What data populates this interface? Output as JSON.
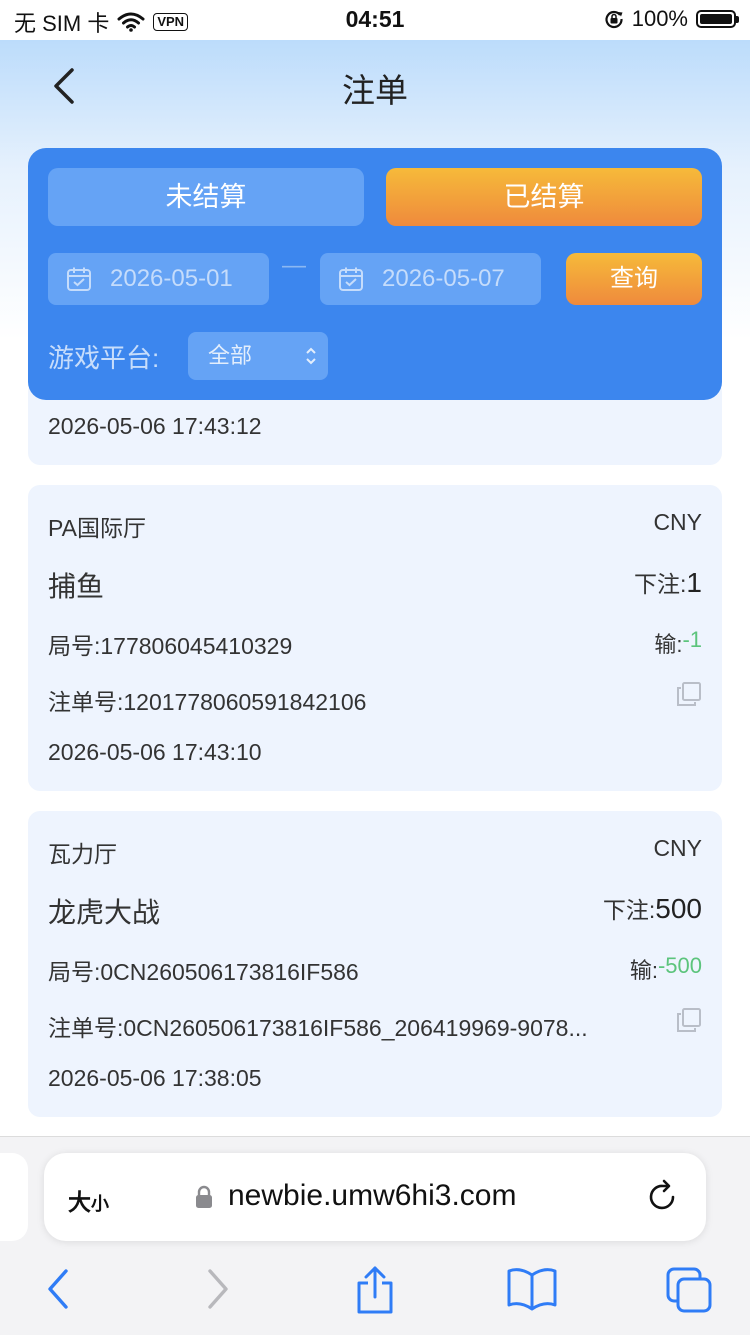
{
  "status_bar": {
    "carrier": "无 SIM 卡",
    "vpn": "VPN",
    "time": "04:51",
    "battery": "100%"
  },
  "header": {
    "title": "注单"
  },
  "filter": {
    "tabs": [
      "未结算",
      "已结算"
    ],
    "active_tab": "已结算",
    "start_date": "2026-05-01",
    "separator": "—",
    "end_date": "2026-05-07",
    "query_label": "查询",
    "platform_label": "游戏平台:",
    "platform_value": "全部"
  },
  "bets": [
    {
      "time": "2026-05-06 17:43:12"
    },
    {
      "hall": "PA国际厅",
      "currency": "CNY",
      "game": "捕鱼",
      "bet_label": "下注:",
      "bet_amount": "1",
      "round_label": "局号:",
      "round_no": "177806045410329",
      "result_label": "输:",
      "result_amount": "-1",
      "order_label": "注单号:",
      "order_no": "1201778060591842106",
      "time": "2026-05-06 17:43:10"
    },
    {
      "hall": "瓦力厅",
      "currency": "CNY",
      "game": "龙虎大战",
      "bet_label": "下注:",
      "bet_amount": "500",
      "round_label": "局号:",
      "round_no": "0CN260506173816IF586",
      "result_label": "输:",
      "result_amount": "-500",
      "order_label": "注单号:",
      "order_no": "0CN260506173816IF586_206419969-9078...",
      "time": "2026-05-06 17:38:05"
    }
  ],
  "browser": {
    "aa_big": "大",
    "aa_small": "小",
    "url": "newbie.umw6hi3.com"
  },
  "colors": {
    "panel_blue": "#3c86ee",
    "orange": "#ef8a3c",
    "loss_green": "#5cc47c",
    "safari_blue": "#2f7cf6"
  }
}
